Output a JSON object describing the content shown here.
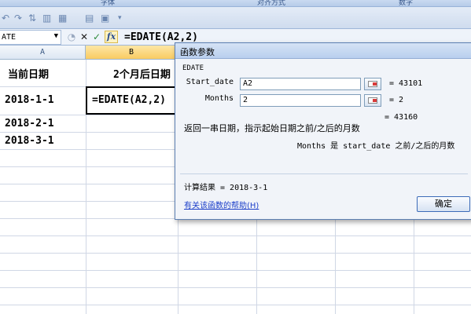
{
  "ribbon": {
    "groups": [
      "字体",
      "对齐方式",
      "数字"
    ]
  },
  "formula_bar": {
    "name_box": "ATE",
    "formula": "=EDATE(A2,2)",
    "cancel_icon": "close-icon",
    "enter_icon": "check-icon",
    "fx_label": "fx"
  },
  "columns": {
    "a": "A",
    "b": "B"
  },
  "sheet": {
    "a1": "当前日期",
    "b1": "2个月后日期",
    "a2": "2018-1-1",
    "b2": "=EDATE(A2,2)",
    "a3": "2018-2-1",
    "a4": "2018-3-1"
  },
  "dialog": {
    "title": "函数参数",
    "function_name": "EDATE",
    "args": [
      {
        "label": "Start_date",
        "value": "A2",
        "result": "= 43101"
      },
      {
        "label": "Months",
        "value": "2",
        "result": "= 2"
      }
    ],
    "overall_result": "= 43160",
    "description": "返回一串日期，指示起始日期之前/之后的月数",
    "arg_description": "Months  是 start_date 之前/之后的月数",
    "calc_result": "计算结果 = 2018-3-1",
    "help_link": "有关该函数的帮助(H)",
    "ok_label": "确定"
  },
  "colors": {
    "selected_column": "#f9cb62",
    "dialog_border": "#5c7fb3",
    "link": "#1b3ec9"
  }
}
